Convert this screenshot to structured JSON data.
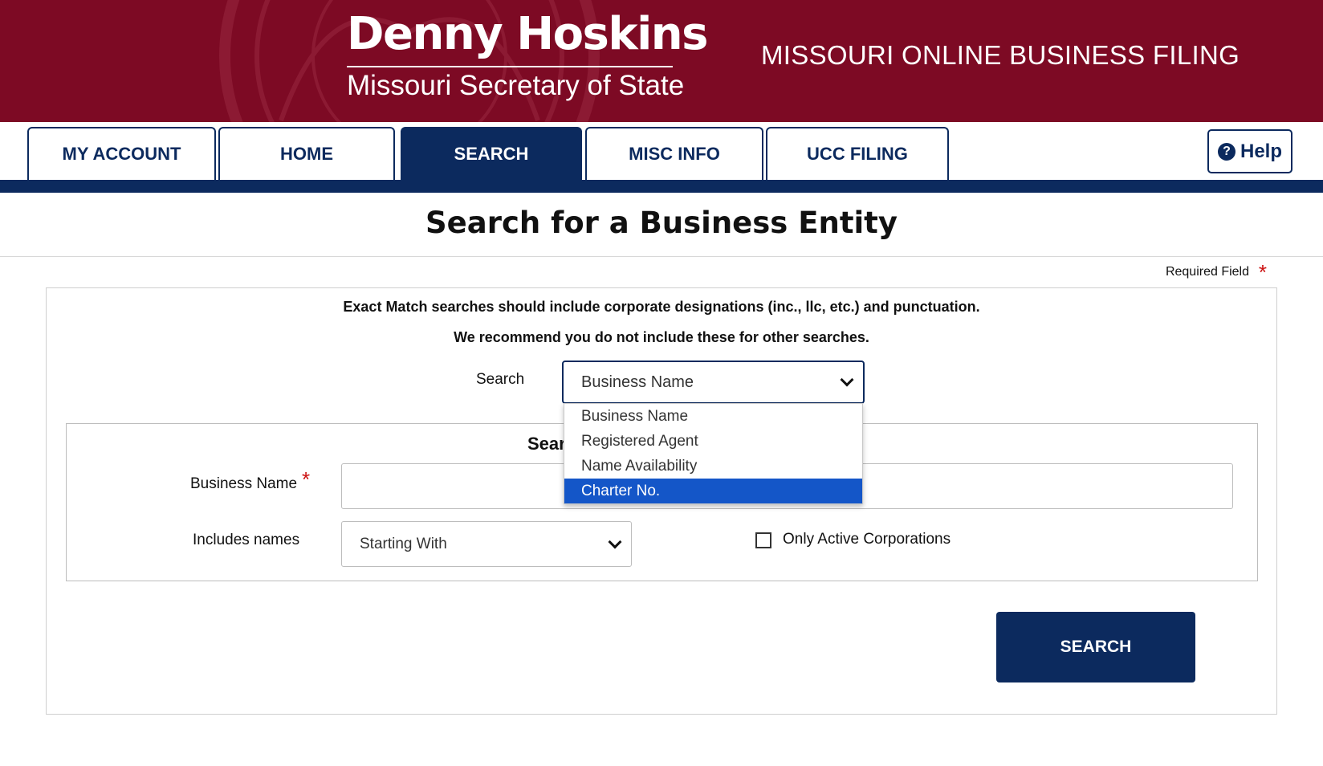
{
  "header": {
    "name": "Denny Hoskins",
    "subtitle": "Missouri Secretary of State",
    "site_title": "MISSOURI ONLINE BUSINESS FILING"
  },
  "nav": {
    "tabs": [
      {
        "label": "MY ACCOUNT",
        "active": false
      },
      {
        "label": "HOME",
        "active": false
      },
      {
        "label": "SEARCH",
        "active": true
      },
      {
        "label": "MISC INFO",
        "active": false
      },
      {
        "label": "UCC FILING",
        "active": false
      }
    ],
    "help_label": "Help"
  },
  "page": {
    "title": "Search for a Business Entity",
    "required_note": "Required Field",
    "required_marker": "*"
  },
  "notes": {
    "line1": "Exact Match searches should include corporate designations (inc., llc, etc.) and punctuation.",
    "line2": "We recommend you do not include these for other searches."
  },
  "search_type": {
    "label": "Search",
    "selected": "Business Name",
    "options": [
      "Business Name",
      "Registered Agent",
      "Name Availability",
      "Charter No."
    ],
    "highlighted": "Charter No."
  },
  "form": {
    "section_title_visible": "Sear",
    "business_name_label": "Business Name",
    "business_name_value": "",
    "includes_label": "Includes names",
    "includes_selected": "Starting With",
    "only_active_label": "Only Active Corporations",
    "only_active_checked": false,
    "submit_label": "SEARCH"
  },
  "colors": {
    "banner": "#7d0a24",
    "navy": "#0c2a5e",
    "highlight": "#1456c8",
    "required": "#cc1111"
  }
}
